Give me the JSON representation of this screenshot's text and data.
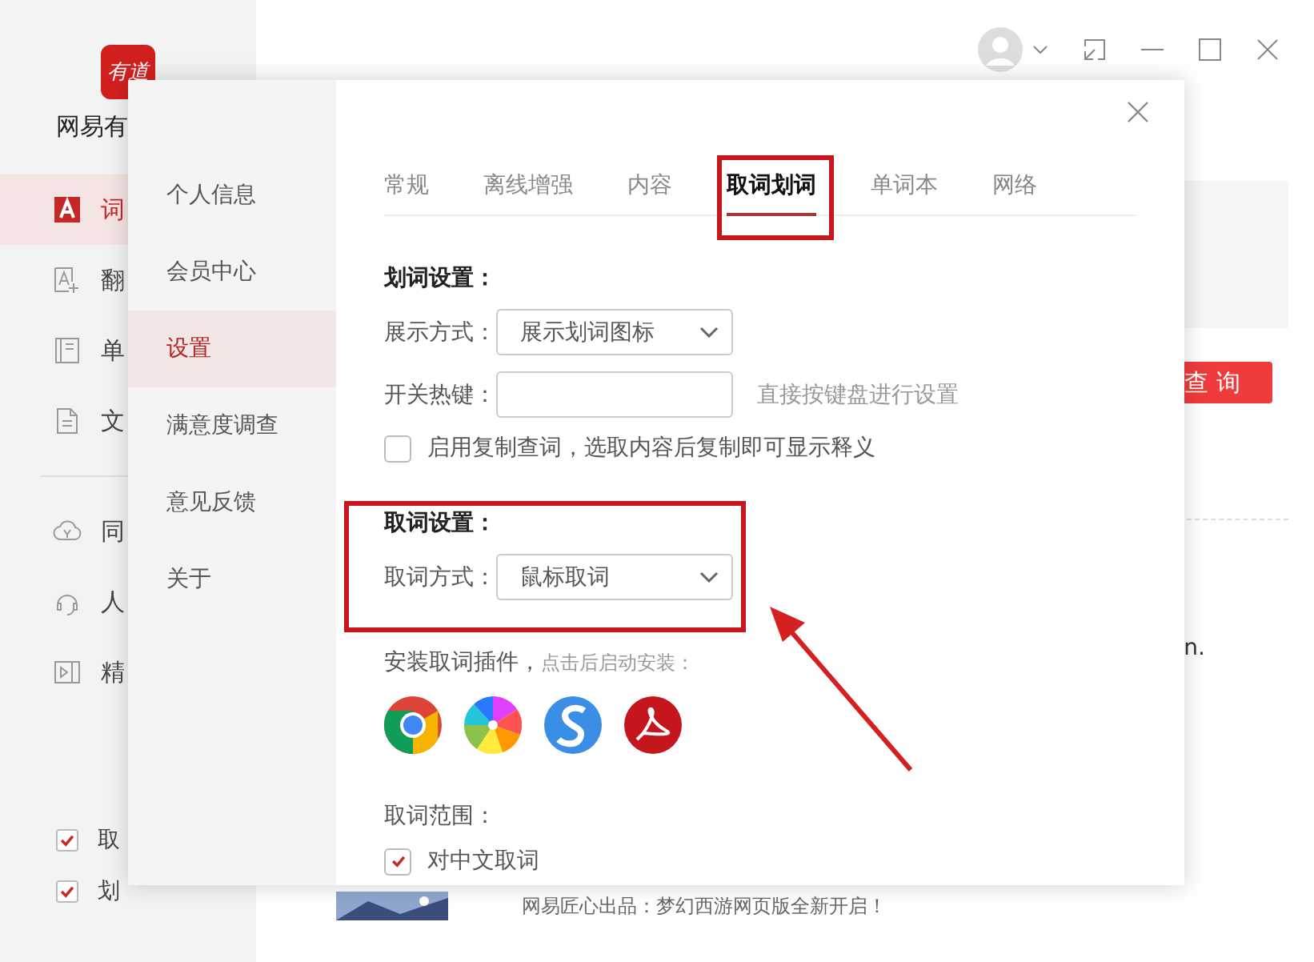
{
  "app": {
    "logo_text": "有道",
    "name": "网易有",
    "nav_main": [
      {
        "label": "词",
        "selected": true
      },
      {
        "label": "翻",
        "selected": false
      },
      {
        "label": "单",
        "selected": false
      },
      {
        "label": "文",
        "selected": false
      }
    ],
    "nav_services": [
      {
        "label": "同",
        "selected": false
      },
      {
        "label": "人",
        "selected": false
      },
      {
        "label": "精",
        "selected": false
      }
    ],
    "toggles": [
      {
        "label": "取",
        "checked": true
      },
      {
        "label": "划",
        "checked": true
      }
    ],
    "search_button": "查 询",
    "snippet": "n.",
    "banner": "网易匠心出品：梦幻西游网页版全新开启！"
  },
  "dialog": {
    "menu": [
      {
        "label": "个人信息",
        "selected": false
      },
      {
        "label": "会员中心",
        "selected": false
      },
      {
        "label": "设置",
        "selected": true
      },
      {
        "label": "满意度调查",
        "selected": false
      },
      {
        "label": "意见反馈",
        "selected": false
      },
      {
        "label": "关于",
        "selected": false
      }
    ],
    "tabs": [
      {
        "label": "常规",
        "selected": false
      },
      {
        "label": "离线增强",
        "selected": false
      },
      {
        "label": "内容",
        "selected": false
      },
      {
        "label": "取词划词",
        "selected": true
      },
      {
        "label": "单词本",
        "selected": false
      },
      {
        "label": "网络",
        "selected": false
      }
    ],
    "select_section": {
      "heading": "划词设置：",
      "display_label": "展示方式：",
      "display_value": "展示划词图标",
      "hotkey_label": "开关热键：",
      "hotkey_hint": "直接按键盘进行设置",
      "copy_lookup": {
        "label": "启用复制查词，选取内容后复制即可显示释义",
        "checked": false
      }
    },
    "capture_section": {
      "heading": "取词设置：",
      "mode_label": "取词方式：",
      "mode_value": "鼠标取词"
    },
    "plugins_label": "安装取词插件，",
    "plugins_hint": "点击后启动安装：",
    "range_label": "取词范围：",
    "range_options": [
      {
        "label": "对中文取词",
        "checked": true
      }
    ]
  }
}
